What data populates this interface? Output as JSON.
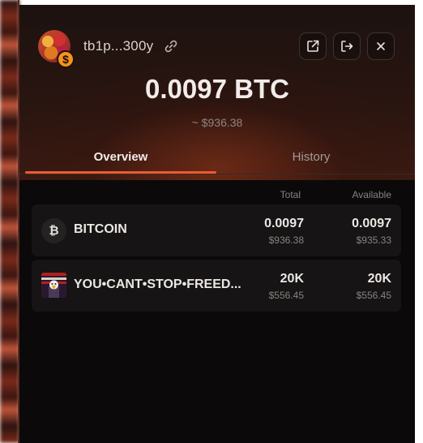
{
  "header": {
    "address": "tb1p...300y",
    "badge_symbol": "$",
    "icons": [
      "link-icon",
      "external-link-icon",
      "logout-icon",
      "close-icon"
    ]
  },
  "balance": {
    "amount": "0.0097 BTC",
    "fiat": "~ $936.38"
  },
  "tabs": [
    {
      "label": "Overview",
      "active": true
    },
    {
      "label": "History",
      "active": false
    }
  ],
  "table": {
    "headers": {
      "total": "Total",
      "available": "Available"
    },
    "rows": [
      {
        "icon": "bitcoin-icon",
        "icon_glyph": "₿",
        "name": "BITCOIN",
        "total": "0.0097",
        "total_fiat": "$936.38",
        "available": "0.0097",
        "available_fiat": "$935.33"
      },
      {
        "icon": "rune-image-icon",
        "name": "YOU•CANT•STOP•FREED...",
        "total": "20K",
        "total_fiat": "$556.45",
        "available": "20K",
        "available_fiat": "$556.45"
      }
    ]
  },
  "colors": {
    "accent": "#ec5a2f",
    "panel_bg": "#0b0909",
    "row_bg": "#161414",
    "badge": "#f7931a"
  }
}
